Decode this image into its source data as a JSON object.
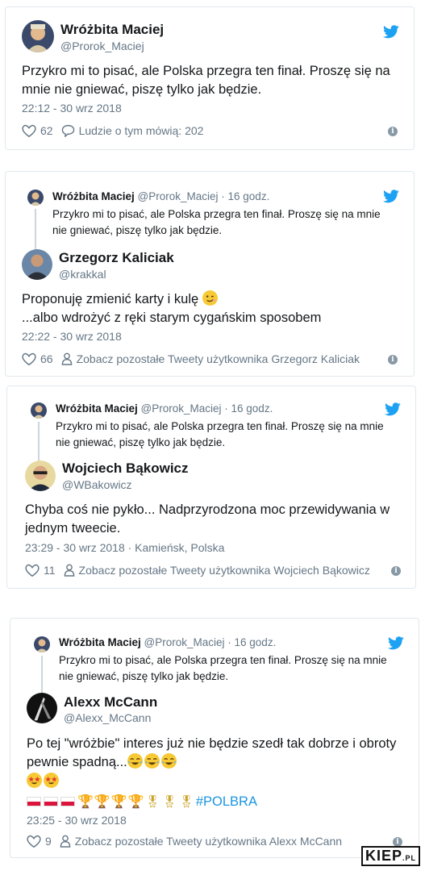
{
  "colors": {
    "twitter_blue": "#1da1f2",
    "text": "#14171a",
    "muted": "#657786",
    "hashtag": "#1b95e0"
  },
  "quoted": {
    "name": "Wróżbita Maciej",
    "handle_time": "@Prorok_Maciej · 16 godz.",
    "text": "Przykro mi to pisać, ale Polska przegra ten finał. Proszę się na mnie nie gniewać, piszę tylko jak będzie."
  },
  "tweet1": {
    "name": "Wróżbita Maciej",
    "handle": "@Prorok_Maciej",
    "text": "Przykro mi to pisać, ale Polska przegra ten finał. Proszę się na mnie nie gniewać, piszę tylko jak będzie.",
    "time": "22:12 - 30 wrz 2018",
    "likes": "62",
    "reply_label": "Ludzie o tym mówią: 202",
    "icons": [
      "heart-icon",
      "comment-icon",
      "info-icon",
      "twitter-bird-icon"
    ]
  },
  "tweet2": {
    "name": "Grzegorz Kaliciak",
    "handle": "@krakkal",
    "text_line1": "Proponuję zmienić karty i kulę",
    "text_line2": "...albo wdrożyć z ręki starym cygańskim sposobem",
    "time": "22:22 - 30 wrz 2018",
    "likes": "66",
    "see_more": "Zobacz pozostałe Tweety użytkownika Grzegorz Kaliciak"
  },
  "tweet3": {
    "name": "Wojciech Bąkowicz",
    "handle": "@WBakowicz",
    "text": "Chyba coś nie pykło... Nadprzyrodzona moc przewidywania w jednym tweecie.",
    "time": "23:29 - 30 wrz 2018 · Kamieńsk, Polska",
    "likes": "11",
    "see_more": "Zobacz pozostałe Tweety użytkownika Wojciech Bąkowicz"
  },
  "tweet4": {
    "name": "Alexx McCann",
    "handle": "@Alexx_McCann",
    "text": "Po tej \"wróżbie\" interes już nie będzie szedł tak dobrze i obroty pewnie spadną...",
    "hashtag": "#POLBRA",
    "time": "23:25 - 30 wrz 2018",
    "likes": "9",
    "see_more": "Zobacz pozostałe Tweety użytkownika Alexx McCann"
  },
  "watermark": {
    "main": "KIEP",
    "suffix": ".PL"
  }
}
